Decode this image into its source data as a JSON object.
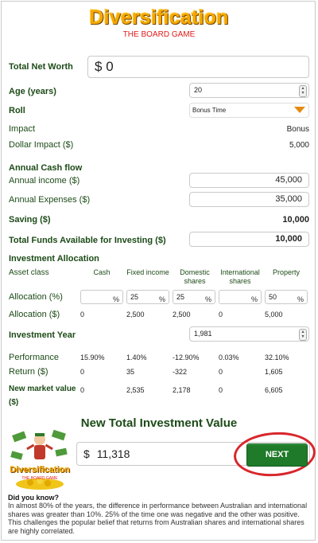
{
  "header": {
    "title": "Diversification",
    "subtitle": "THE BOARD GAME"
  },
  "net_worth": {
    "label": "Total Net Worth",
    "currency": "$",
    "value": "0"
  },
  "age": {
    "label": "Age (years)",
    "value": "20"
  },
  "roll": {
    "label": "Roll",
    "value": "Bonus Time"
  },
  "impact": {
    "label": "Impact",
    "value": "Bonus"
  },
  "dollar_impact": {
    "label": "Dollar Impact ($)",
    "value": "5,000"
  },
  "cash_flow": {
    "heading": "Annual Cash flow",
    "income_label": "Annual income ($)",
    "income_value": "45,000",
    "expenses_label": "Annual Expenses ($)",
    "expenses_value": "35,000",
    "saving_label": "Saving ($)",
    "saving_value": "10,000",
    "funds_label": "Total Funds Available for Investing ($)",
    "funds_value": "10,000"
  },
  "allocation": {
    "heading": "Investment Allocation",
    "asset_class_label": "Asset class",
    "columns": [
      "Cash",
      "Fixed income",
      "Domestic shares",
      "International shares",
      "Property"
    ],
    "alloc_pct_label": "Allocation (%)",
    "alloc_pct_values": [
      "",
      "25",
      "25",
      "",
      "50"
    ],
    "pct_symbol": "%",
    "alloc_dollar_label": "Allocation ($)",
    "alloc_dollar_values": [
      "0",
      "2,500",
      "2,500",
      "0",
      "5,000"
    ]
  },
  "investment_year": {
    "label": "Investment Year",
    "value": "1,981"
  },
  "performance": {
    "label": "Performance",
    "values": [
      "15.90%",
      "1.40%",
      "-12.90%",
      "0.03%",
      "32.10%"
    ]
  },
  "returns": {
    "label": "Return ($)",
    "values": [
      "0",
      "35",
      "-322",
      "0",
      "1,605"
    ]
  },
  "market_value": {
    "label_line1": "New market value",
    "label_line2": "($)",
    "values": [
      "0",
      "2,535",
      "2,178",
      "0",
      "6,605"
    ]
  },
  "total_investment": {
    "title": "New Total Investment Value",
    "currency": "$",
    "value": "11,318"
  },
  "next_button": {
    "label": "NEXT"
  },
  "logo": {
    "title": "Diversification",
    "subtitle": "THE BOARD GAME"
  },
  "did_you_know": {
    "title": "Did you know?",
    "text": "In almost 80% of the years, the difference in performance between Australian and international shares was greater than 10%. 25% of the time one was negative and the other was positive. This challenges the popular belief that returns from Australian shares and international shares are highly correlated."
  },
  "colors": {
    "accent": "#1f7a2a",
    "label": "#1c4b17",
    "title": "#f5a800",
    "subtitle": "#e21a1a",
    "highlight": "#d8262c"
  }
}
